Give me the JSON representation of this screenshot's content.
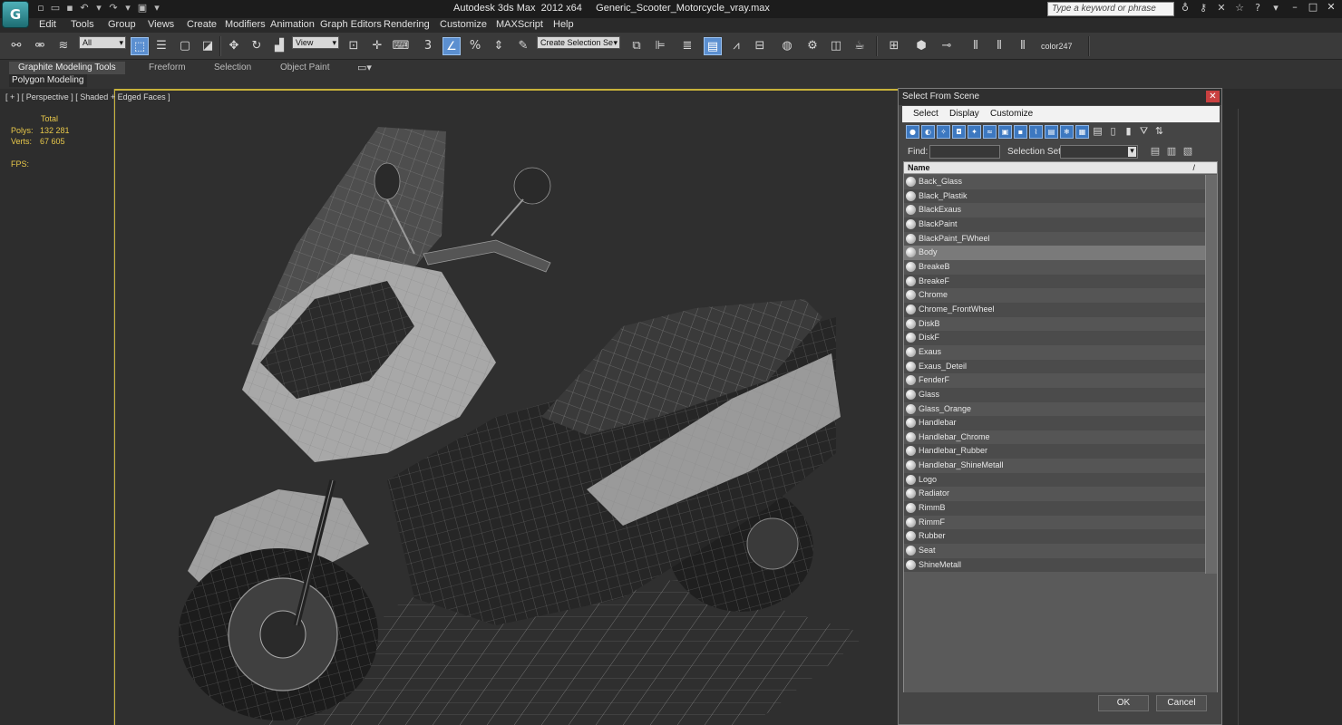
{
  "window": {
    "title": "Autodesk 3ds Max  2012 x64     Generic_Scooter_Motorcycle_vray.max",
    "search_placeholder": "Type a keyword or phrase",
    "app_logo": "3ds-max-logo"
  },
  "menu": [
    "Edit",
    "Tools",
    "Group",
    "Views",
    "Create",
    "Modifiers",
    "Animation",
    "Graph Editors",
    "Rendering",
    "Customize",
    "MAXScript",
    "Help"
  ],
  "toolbar": {
    "filter_value": "All",
    "view_value": "View",
    "selection_set_value": "Create Selection Se",
    "snap_value": "3",
    "color_label": "color247"
  },
  "ribbon": {
    "tabs": [
      "Graphite Modeling Tools",
      "Freeform",
      "Selection",
      "Object Paint"
    ],
    "panel": "Polygon Modeling"
  },
  "stats": {
    "total_label": "Total",
    "polys_label": "Polys:",
    "polys_value": "132 281",
    "verts_label": "Verts:",
    "verts_value": "67 605",
    "fps_label": "FPS:"
  },
  "viewport": {
    "label": "[ + ] [ Perspective ] [ Shaded + Edged Faces ]"
  },
  "dialog": {
    "title": "Select From Scene",
    "menu": [
      "Select",
      "Display",
      "Customize"
    ],
    "find_label": "Find:",
    "find_value": "",
    "selection_set_label": "Selection Set:",
    "column_header": "Name",
    "sort_indicator": "/",
    "selected_item": "Body",
    "items": [
      "Back_Glass",
      "Black_Plastik",
      "BlackExaus",
      "BlackPaint",
      "BlackPaint_FWheel",
      "Body",
      "BreakeB",
      "BreakeF",
      "Chrome",
      "Chrome_FrontWheel",
      "DiskB",
      "DiskF",
      "Exaus",
      "Exaus_Deteil",
      "FenderF",
      "Glass",
      "Glass_Orange",
      "Handlebar",
      "Handlebar_Chrome",
      "Handlebar_Rubber",
      "Handlebar_ShineMetall",
      "Logo",
      "Radiator",
      "RimmB",
      "RimmF",
      "Rubber",
      "Seat",
      "ShineMetall"
    ],
    "ok_label": "OK",
    "cancel_label": "Cancel"
  },
  "colors": {
    "viewport_border": "#c9b33a",
    "stats_text": "#e8c84a",
    "active_tool": "#5b8fd0",
    "close_button": "#c94040"
  }
}
